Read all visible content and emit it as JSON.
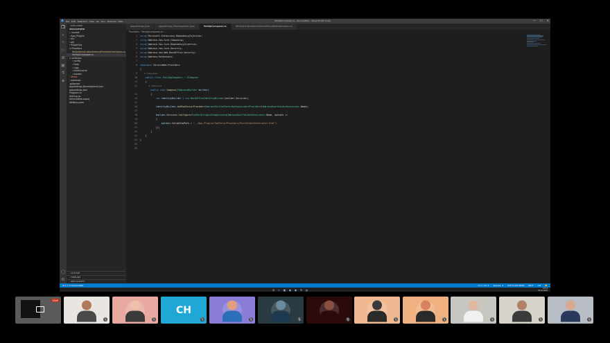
{
  "app": {
    "menu": [
      "File",
      "Edit",
      "Selection",
      "View",
      "Go",
      "Run",
      "Terminal",
      "Help"
    ],
    "window_title": "YotiIdpComposer.cs - ServiceWeb - Visual Studio Code",
    "window_controls": [
      "—",
      "☐",
      "✕"
    ]
  },
  "sidebar": {
    "header": "EXPLORER",
    "project": "SERVICEWEB",
    "tree": [
      {
        "label": "› .vscode",
        "indent": 1,
        "state": ""
      },
      {
        "label": "› App_Plugins",
        "indent": 1,
        "state": ""
      },
      {
        "label": "› bin",
        "indent": 1,
        "state": ""
      },
      {
        "label": "› obj",
        "indent": 1,
        "state": ""
      },
      {
        "label": "› Properties",
        "indent": 1,
        "state": ""
      },
      {
        "label": "∨ Providers",
        "indent": 1,
        "state": ""
      },
      {
        "label": "  YotiAuthenticationExternalProviderExtensions.cs",
        "indent": 2,
        "state": "mod"
      },
      {
        "label": "  YotiIdpComposer.cs",
        "indent": 2,
        "state": "sel"
      },
      {
        "label": "∨ umbraco",
        "indent": 1,
        "state": ""
      },
      {
        "label": "› config",
        "indent": 2,
        "state": ""
      },
      {
        "label": "› Data",
        "indent": 2,
        "state": ""
      },
      {
        "label": "› Logs",
        "indent": 2,
        "state": ""
      },
      {
        "label": "› mediacache",
        "indent": 2,
        "state": ""
      },
      {
        "label": "› models",
        "indent": 2,
        "state": ""
      },
      {
        "label": "› Views",
        "indent": 1,
        "state": "red"
      },
      {
        "label": "› wwwroot",
        "indent": 1,
        "state": ""
      },
      {
        "label": "  .gitignore",
        "indent": 1,
        "state": ""
      },
      {
        "label": "  appsettings.Development.json",
        "indent": 1,
        "state": ""
      },
      {
        "label": "  appsettings.json",
        "indent": 1,
        "state": ""
      },
      {
        "label": "  Program.cs",
        "indent": 1,
        "state": ""
      },
      {
        "label": "  Startup.cs",
        "indent": 1,
        "state": ""
      },
      {
        "label": "  ServiceWeb.csproj",
        "indent": 1,
        "state": ""
      },
      {
        "label": "  YotiKeys.pem",
        "indent": 1,
        "state": ""
      }
    ],
    "bottom_sections": [
      "› OUTLINE",
      "› TIMELINE",
      "› NPM SCRIPTS"
    ]
  },
  "tabs": [
    {
      "label": "appsettings.json",
      "active": false
    },
    {
      "label": "appsettings.Development.json",
      "active": false
    },
    {
      "label": "YotiIdpComposer.cs",
      "active": true
    },
    {
      "label": "YotiAuthenticationExternalProviderExtensions.cs",
      "active": false
    }
  ],
  "breadcrumb": "Providers › YotiIdpComposer.cs › ...",
  "editor": {
    "line_numbers": [
      "1",
      "2",
      "3",
      "4",
      "5",
      "6",
      "7",
      "8",
      "",
      "9",
      "10",
      "11",
      "12",
      "",
      "13",
      "14",
      "15",
      "16",
      "17",
      "18",
      "19",
      "20",
      "21",
      "22",
      "23",
      "24",
      "25",
      "26"
    ],
    "lines": [
      [
        [
          "kw",
          "using "
        ],
        [
          "ns",
          "Microsoft.Extensions.DependencyInjection;"
        ]
      ],
      [
        [
          "kw",
          "using "
        ],
        [
          "ns",
          "Umbraco.Cms.Core.Composing;"
        ]
      ],
      [
        [
          "kw",
          "using "
        ],
        [
          "ns",
          "Umbraco.Cms.Core.DependencyInjection;"
        ]
      ],
      [
        [
          "kw",
          "using "
        ],
        [
          "ns",
          "Umbraco.Cms.Core.Security;"
        ]
      ],
      [
        [
          "kw",
          "using "
        ],
        [
          "ns",
          "Umbraco.Cms.Web.BackOffice.Security;"
        ]
      ],
      [
        [
          "kw",
          "using "
        ],
        [
          "ns",
          "Umbraco.Extensions;"
        ]
      ],
      [
        [
          "ns",
          ""
        ]
      ],
      [
        [
          "kw",
          "namespace "
        ],
        [
          "ns",
          "ServiceWeb.Providers"
        ]
      ],
      [
        [
          "ns",
          "{"
        ]
      ],
      [
        [
          "ref",
          "    0 references"
        ]
      ],
      [
        [
          "kw",
          "    public class "
        ],
        [
          "ty",
          "YotiIdpComposer"
        ],
        [
          "ns",
          " : "
        ],
        [
          "ty",
          "IComposer"
        ]
      ],
      [
        [
          "ns",
          "    {"
        ]
      ],
      [
        [
          "ref",
          "        0 references"
        ]
      ],
      [
        [
          "kw",
          "        public void "
        ],
        [
          "fn",
          "Compose"
        ],
        [
          "ns",
          "("
        ],
        [
          "ty",
          "IUmbracoBuilder "
        ],
        [
          "var",
          "builder"
        ],
        [
          "ns",
          ")"
        ]
      ],
      [
        [
          "ns",
          "        {"
        ]
      ],
      [
        [
          "kw",
          "            var "
        ],
        [
          "var",
          "identityBuilder"
        ],
        [
          "ns",
          " = "
        ],
        [
          "kw",
          "new "
        ],
        [
          "ty",
          "BackOfficeIdentityBuilder"
        ],
        [
          "ns",
          "(builder.Services);"
        ]
      ],
      [
        [
          "ns",
          ""
        ]
      ],
      [
        [
          "var",
          "            identityBuilder"
        ],
        [
          "ns",
          "."
        ],
        [
          "fn",
          "AddTwoFactorProvider"
        ],
        [
          "ns",
          "<"
        ],
        [
          "ty",
          "UmbracoYotiTwoFactorAuthenticatorProvider"
        ],
        [
          "ns",
          ">("
        ],
        [
          "ty",
          "UmbracoUserYotiAuthenticator"
        ],
        [
          "ns",
          ".Name);"
        ]
      ],
      [
        [
          "ns",
          ""
        ]
      ],
      [
        [
          "var",
          "            builder"
        ],
        [
          "ns",
          ".Services."
        ],
        [
          "fn",
          "Configure"
        ],
        [
          "ns",
          "<"
        ],
        [
          "ty",
          "TwoFactorLoginViewOptions"
        ],
        [
          "ns",
          ">("
        ],
        [
          "ty",
          "UmbracoUserYotiAuthenticator"
        ],
        [
          "ns",
          ".Name, options =>"
        ]
      ],
      [
        [
          "ns",
          "            {"
        ]
      ],
      [
        [
          "var",
          "                options"
        ],
        [
          "ns",
          ".SetupViewPath = "
        ],
        [
          "str",
          "\"../App_Plugins/TwoFactorProviders/UserYotiAuthenticator.html\""
        ],
        [
          "ns",
          ";"
        ]
      ],
      [
        [
          "ns",
          "            });"
        ]
      ],
      [
        [
          "ns",
          "        }"
        ]
      ],
      [
        [
          "ns",
          "    }"
        ]
      ],
      [
        [
          "ns",
          "}"
        ]
      ],
      [
        [
          "ns",
          ""
        ]
      ],
      [
        [
          "ns",
          ""
        ]
      ]
    ]
  },
  "statusbar": {
    "left": "⊗ 0 ⚠ 0   ServiceWeb",
    "right": [
      "Ln 1, Col 1",
      "Spaces: 4",
      "UTF-8 with BOM",
      "CRLF",
      "C#",
      "🔔"
    ]
  },
  "taskbar": {
    "icons": [
      "⊞",
      "⌕",
      "▣",
      "◉",
      "◆",
      "✉",
      "▤"
    ],
    "time": "13:57",
    "date": "03-01-2022"
  },
  "participants": [
    {
      "kind": "share",
      "badge": "Live"
    },
    {
      "kind": "video",
      "bg": "#e9e6e2",
      "skin": "#b07a5c",
      "shirt": "#4a4a4a"
    },
    {
      "kind": "avatar",
      "bg": "#e9a8a0",
      "skin": "#f0c0a8",
      "shirt": "#3a3a3a"
    },
    {
      "kind": "initials",
      "bg": "#1fa7d6",
      "text": "CH"
    },
    {
      "kind": "avatar",
      "bg": "#8a7dd8",
      "skin": "#e0a080",
      "shirt": "#2a6fb8"
    },
    {
      "kind": "avatar",
      "bg": "#2a3a42",
      "skin": "#6a8aa0",
      "shirt": "#1e3a50"
    },
    {
      "kind": "avatar",
      "bg": "#2a0a0a",
      "skin": "#8a5040",
      "shirt": "#2a0a0a"
    },
    {
      "kind": "avatar",
      "bg": "#f0b890",
      "skin": "#3a3a3a",
      "shirt": "#2a2a2a"
    },
    {
      "kind": "avatar",
      "bg": "#f0b080",
      "skin": "#d88060",
      "shirt": "#2a2a2a"
    },
    {
      "kind": "video",
      "bg": "#c8c6c0",
      "skin": "#e0b8a0",
      "shirt": "#f0f0f0"
    },
    {
      "kind": "video",
      "bg": "#d8d4cc",
      "skin": "#b08068",
      "shirt": "#3a3a3a"
    },
    {
      "kind": "video",
      "bg": "#b8bcc4",
      "skin": "#d8a890",
      "shirt": "#2a3a5a"
    }
  ]
}
